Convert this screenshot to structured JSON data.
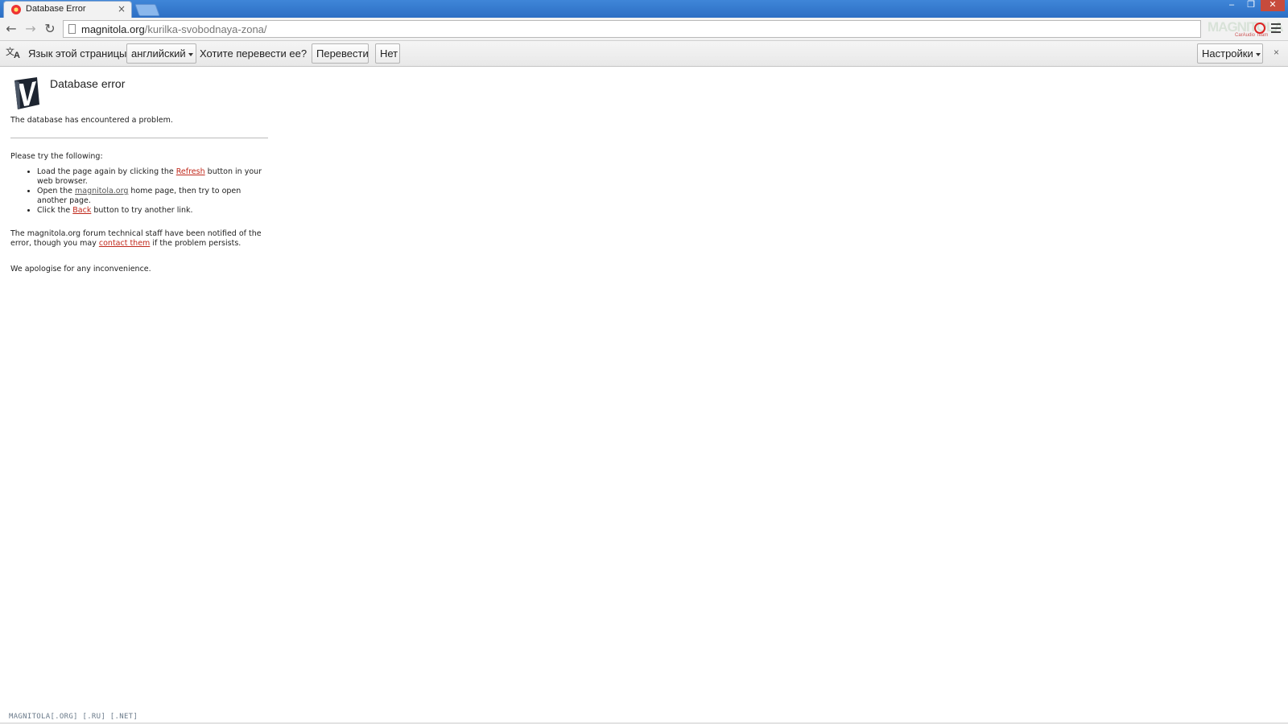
{
  "browser": {
    "tab": {
      "title": "Database Error",
      "close": "×"
    },
    "window": {
      "minimize": "–",
      "maximize": "❐",
      "close": "✕"
    },
    "nav": {
      "back": "←",
      "forward": "→",
      "reload": "↻"
    },
    "address": {
      "host": "magnitola.org",
      "path": "/kurilka-svobodnaya-zona/"
    },
    "extension": {
      "logo_text": "MAGNITOLA",
      "sub_text": "CarAudio Team"
    }
  },
  "translate_bar": {
    "lang_label": "Язык этой страницы",
    "lang_value": "английский",
    "question": "Хотите перевести ее?",
    "translate_button": "Перевести",
    "no_button": "Нет",
    "settings_button": "Настройки",
    "close": "×"
  },
  "page": {
    "heading": "Database error",
    "lead": "The database has encountered a problem.",
    "try_label": "Please try the following:",
    "tips": [
      {
        "before": "Load the page again by clicking the ",
        "link": "Refresh",
        "after": " button in your web browser."
      },
      {
        "before": "Open the ",
        "link": "magnitola.org",
        "after": " home page, then try to open another page."
      },
      {
        "before": "Click the ",
        "link": "Back",
        "after": " button to try another link."
      }
    ],
    "notice_before": "The magnitola.org forum technical staff have been notified of the error, though you may ",
    "notice_link": "contact them",
    "notice_after": " if the problem persists.",
    "apology": "We apologise for any inconvenience.",
    "footer": "MAGNITOLA[.ORG] [.RU] [.NET]"
  },
  "colors": {
    "link": "#c0281b",
    "titlebar": "#2c6ec4"
  }
}
